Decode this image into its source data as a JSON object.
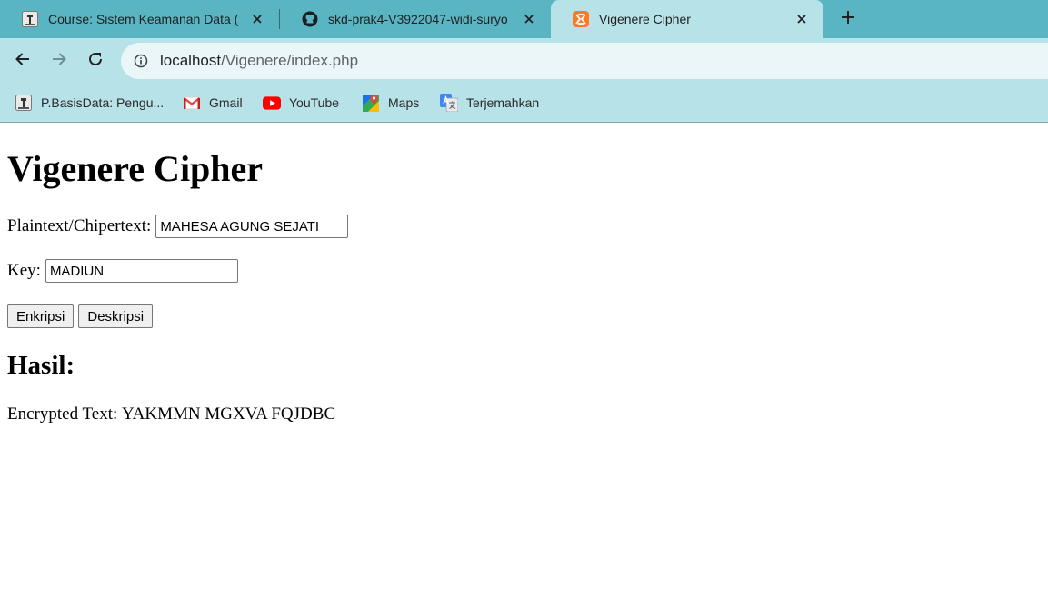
{
  "browser": {
    "tabs": [
      {
        "title": "Course: Sistem Keamanan Data (",
        "favicon": "moodle-icon",
        "active": false
      },
      {
        "title": "skd-prak4-V3922047-widi-suryo",
        "favicon": "github-icon",
        "active": false
      },
      {
        "title": "Vigenere Cipher",
        "favicon": "xampp-icon",
        "active": true
      }
    ],
    "new_tab_icon": "plus-icon",
    "nav": {
      "back_icon": "arrow-left-icon",
      "forward_icon": "arrow-right-icon",
      "reload_icon": "reload-icon"
    },
    "address_bar": {
      "host": "localhost",
      "path": "/Vigenere/index.php",
      "info_icon": "info-icon"
    },
    "bookmarks": [
      {
        "label": "P.BasisData: Pengu...",
        "icon": "moodle-icon"
      },
      {
        "label": "Gmail",
        "icon": "gmail-icon"
      },
      {
        "label": "YouTube",
        "icon": "youtube-icon"
      },
      {
        "label": "Maps",
        "icon": "maps-icon"
      },
      {
        "label": "Terjemahkan",
        "icon": "translate-icon"
      }
    ],
    "colors": {
      "tab_strip": "#5ab5c3",
      "toolbar": "#b7e2e7",
      "omnibox": "#eaf6f8"
    }
  },
  "page": {
    "title": "Vigenere Cipher",
    "plaintext_label": "Plaintext/Chipertext:",
    "plaintext_value": "MAHESA AGUNG SEJATI",
    "key_label": "Key:",
    "key_value": "MADIUN",
    "encrypt_button": "Enkripsi",
    "decrypt_button": "Deskripsi",
    "result_heading": "Hasil:",
    "result_label": "Encrypted Text:",
    "result_value": "YAKMMN MGXVA FQJDBC"
  }
}
